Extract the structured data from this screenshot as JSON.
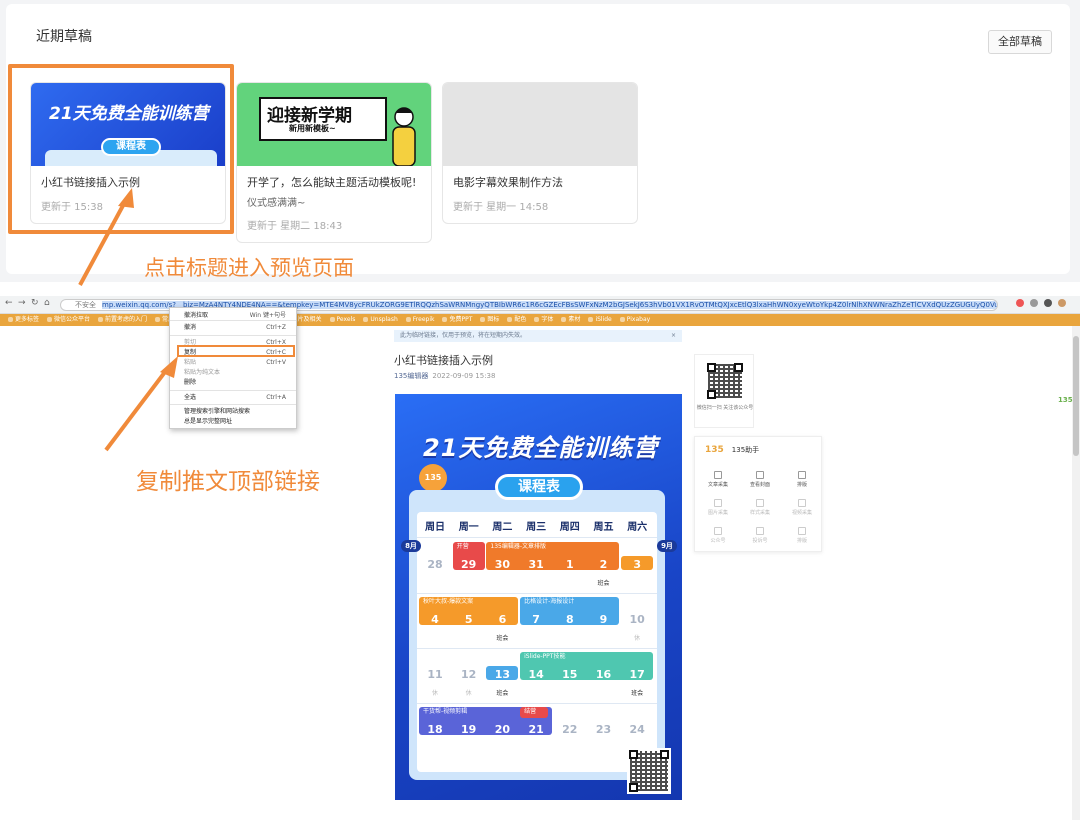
{
  "drafts_section": {
    "title": "近期草稿",
    "all_button": "全部草稿",
    "cards": [
      {
        "title": "小红书链接插入示例",
        "subtitle": "",
        "time": "更新于 15:38",
        "thumb_text": "21天免费全能训练营",
        "thumb_pill": "课程表"
      },
      {
        "title": "开学了，怎么能缺主题活动模板呢!",
        "subtitle": "仪式感满满~",
        "time": "更新于 星期二 18:43",
        "thumb_text": "迎接新学期",
        "thumb_sub": "新用新模板~"
      },
      {
        "title": "电影字幕效果制作方法",
        "subtitle": "",
        "time": "更新于 星期一 14:58"
      }
    ]
  },
  "callouts": {
    "step1": "点击标题进入预览页面",
    "step2": "复制推文顶部链接"
  },
  "browser": {
    "address_prefix": "不安全",
    "url": "mp.weixin.qq.com/s?__biz=MzA4NTY4NDE4NA==&tempkey=MTE4MV8ycFRUkZORG9ETlRQQzhSaWRNMngyQTBIbWR6c1R6cGZEcFBsSWFxNzM2bGJSekJ6S3hVb01VX1RvOTMtQXJxcEtlQ3lxaHhWN0xyeWtoYkp4Z0lrNlhXNWNraZhZeTlCVXdQUzZGUGUyQ0VuRmxoV2tZeGgtLTVpakpKX3hiMFVaWHk2eHF1S0ZZYW8~",
    "bookmarks": [
      "更多标签",
      "微信公众平台",
      "前置考虑的入门",
      "常用",
      "135编辑器",
      "收藏夹",
      "ppt",
      "图片及相关",
      "Pexels",
      "Unsplash",
      "Freepik",
      "免费PPT",
      "图标",
      "配色",
      "字体",
      "素材",
      "iSlide",
      "Pixabay"
    ]
  },
  "context_menu": {
    "items": [
      {
        "label": "撤消拉取",
        "key": "Win 键+句号"
      },
      {
        "label": "撤消",
        "key": "Ctrl+Z"
      },
      {
        "label": "剪切",
        "key": "Ctrl+X"
      },
      {
        "label": "复制",
        "key": "Ctrl+C"
      },
      {
        "label": "粘贴",
        "key": "Ctrl+V"
      },
      {
        "label": "粘贴为纯文本",
        "key": ""
      },
      {
        "label": "删除",
        "key": ""
      },
      {
        "label": "全选",
        "key": "Ctrl+A"
      },
      {
        "label": "管理搜索引擎和网站搜索",
        "key": ""
      },
      {
        "label": "总是显示完整网址",
        "key": ""
      }
    ]
  },
  "article": {
    "notice": "此为临时链接，仅用于预览，将在短期内失效。",
    "notice_close": "×",
    "title": "小红书链接插入示例",
    "author": "135编辑器",
    "date": "2022-09-09 15:38",
    "poster": {
      "headline": "21天免费全能训练营",
      "pill": "课程表",
      "planet": "135",
      "weekdays": [
        "周日",
        "周一",
        "周二",
        "周三",
        "周四",
        "周五",
        "周六"
      ],
      "month_left": "8月",
      "month_right": "9月",
      "week_rows": [
        {
          "days": [
            "28",
            "29",
            "30",
            "31",
            "1",
            "2",
            "3"
          ]
        },
        {
          "days": [
            "4",
            "5",
            "6",
            "7",
            "8",
            "9",
            "10"
          ]
        },
        {
          "days": [
            "11",
            "12",
            "13",
            "14",
            "15",
            "16",
            "17"
          ]
        },
        {
          "days": [
            "18",
            "19",
            "20",
            "21",
            "22",
            "23",
            "24"
          ]
        }
      ],
      "events": {
        "opening": "开营",
        "editor": "135编辑器-文章排版",
        "copy": "秋叶大叔-爆款文案",
        "design": "比格设计-海报设计",
        "ppt": "iSlide-PPT技能",
        "video": "干货帮-视频剪辑",
        "graduation": "结营",
        "class_meeting": "班会",
        "rest": "休"
      }
    }
  },
  "sidebar": {
    "qr_caption": "微信扫一扫 关注该公众号",
    "helper_logo": "135",
    "helper_name": "135助手",
    "helper_actions": [
      "文章采集",
      "查看封面",
      "排版",
      "图片采集",
      "样式采集",
      "视频采集",
      "公众号",
      "投诉号",
      "排版"
    ],
    "side_badge": "135"
  }
}
